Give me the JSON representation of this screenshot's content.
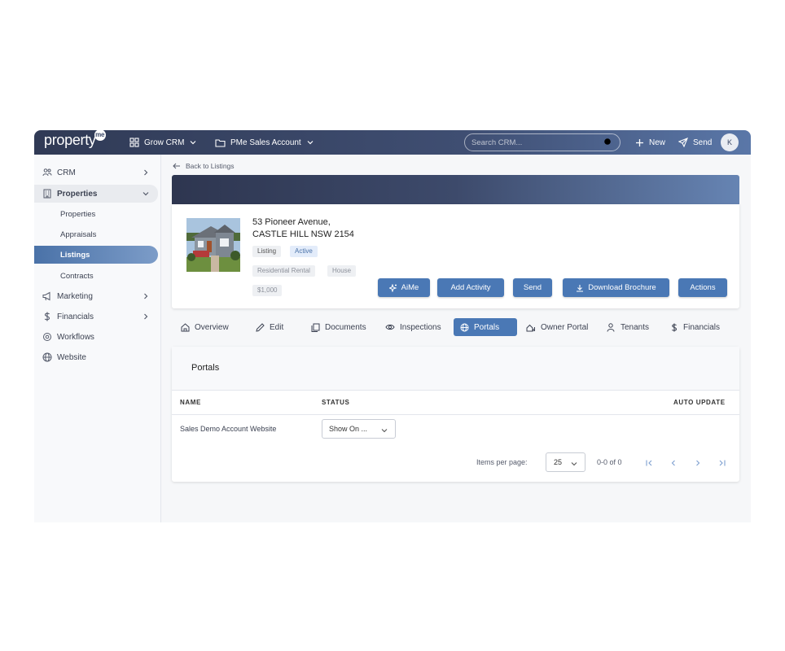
{
  "topbar": {
    "logo": "property",
    "logo_badge": "me",
    "workspace": "Grow CRM",
    "account": "PMe Sales Account",
    "search_placeholder": "Search CRM...",
    "new_label": "New",
    "send_label": "Send",
    "avatar_initial": "K"
  },
  "sidebar": {
    "items": [
      {
        "label": "CRM",
        "icon": "people-icon"
      },
      {
        "label": "Properties",
        "icon": "building-icon"
      },
      {
        "label": "Marketing",
        "icon": "megaphone-icon"
      },
      {
        "label": "Financials",
        "icon": "dollar-icon"
      },
      {
        "label": "Workflows",
        "icon": "workflow-icon"
      },
      {
        "label": "Website",
        "icon": "globe-icon"
      }
    ],
    "sub_items": [
      "Properties",
      "Appraisals",
      "Listings",
      "Contracts"
    ],
    "active_sub": "Listings",
    "collapse_label": "«"
  },
  "back_label": "Back to Listings",
  "listing": {
    "address_line1": "53 Pioneer Avenue,",
    "address_line2": "CASTLE HILL NSW 2154",
    "tags": [
      "Listing",
      "Active",
      "Residential Rental",
      "House",
      "$1,000"
    ]
  },
  "actions": {
    "aime": "AiMe",
    "add_activity": "Add Activity",
    "send": "Send",
    "download_brochure": "Download Brochure",
    "actions": "Actions"
  },
  "tabs": [
    "Overview",
    "Edit",
    "Documents",
    "Inspections",
    "Portals",
    "Owner Portal",
    "Tenants",
    "Financials"
  ],
  "active_tab": "Portals",
  "portals": {
    "title": "Portals",
    "columns": {
      "name": "NAME",
      "status": "STATUS",
      "auto_update": "AUTO UPDATE"
    },
    "rows": [
      {
        "name": "Sales Demo Account Website",
        "status": "Show On ..."
      }
    ],
    "pager": {
      "items_per_page_label": "Items per page:",
      "items_per_page": "25",
      "range": "0-0 of 0"
    }
  },
  "colors": {
    "primary": "#4a78b5",
    "topbar_dark": "#303a55",
    "topbar_light": "#5a77a8"
  }
}
